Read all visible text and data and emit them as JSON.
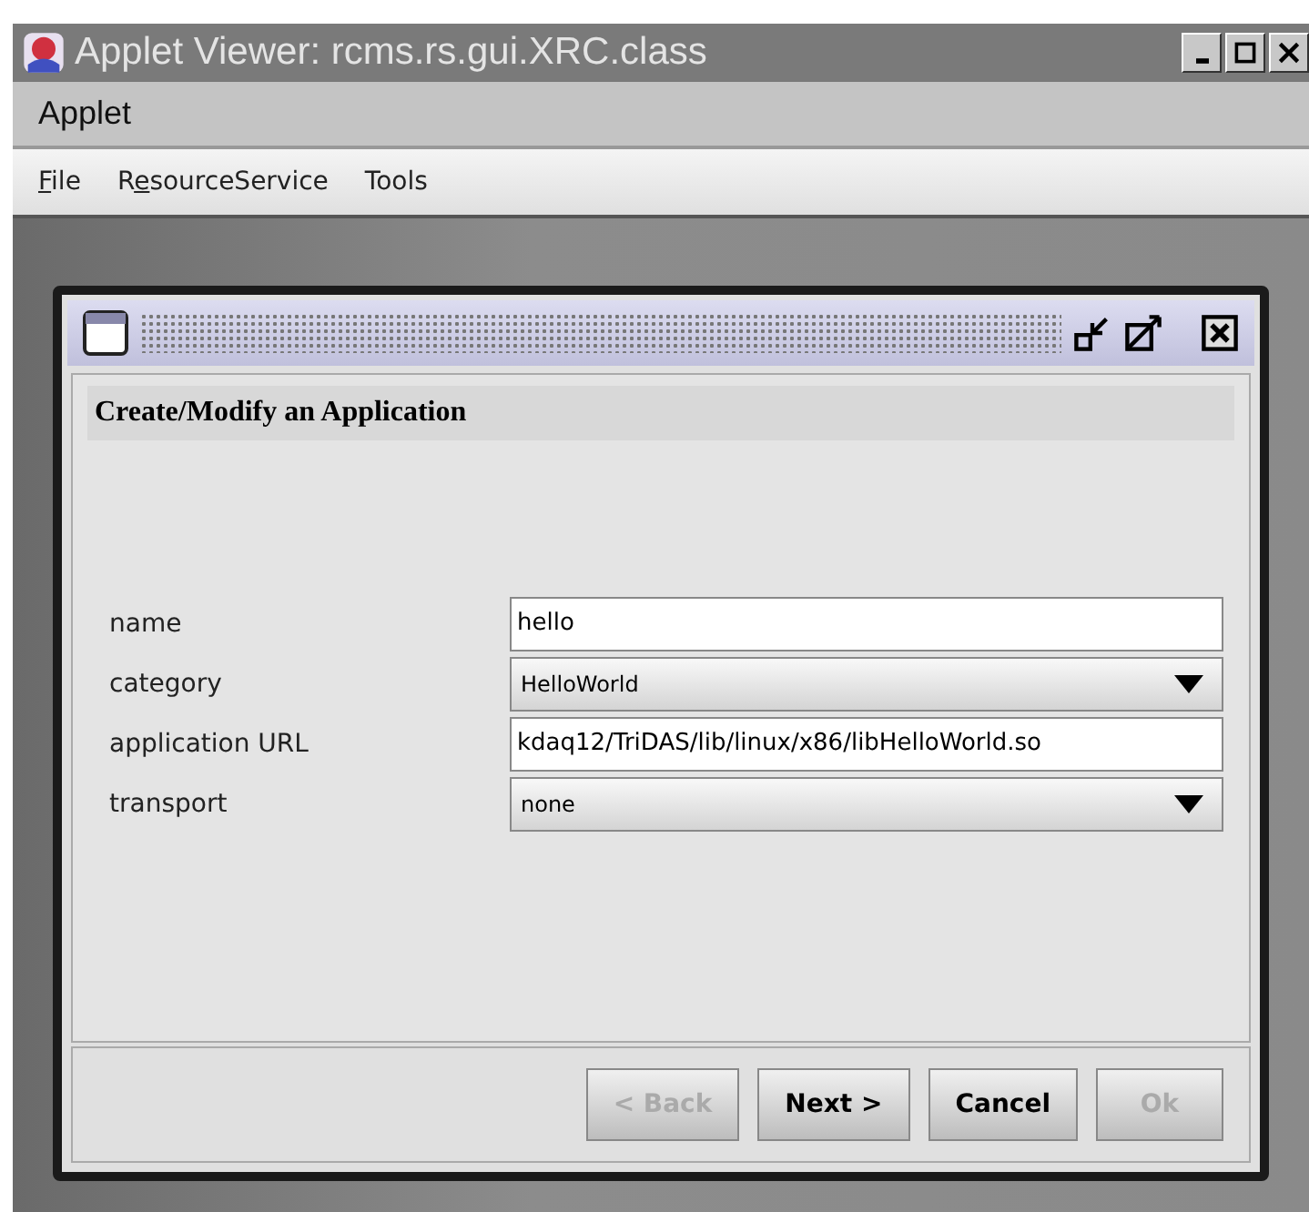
{
  "window": {
    "title": "Applet Viewer: rcms.rs.gui.XRC.class"
  },
  "applet_menu": [
    "Applet"
  ],
  "menu": [
    {
      "underlined": "F",
      "text_after": "ile"
    },
    {
      "text_before": "R",
      "underlined": "e",
      "text_after": "sourceService"
    },
    {
      "text_before": "Tools"
    }
  ],
  "dialog": {
    "heading": "Create/Modify an Application",
    "fields": [
      {
        "label": "name",
        "kind": "text",
        "value": "hello"
      },
      {
        "label": "category",
        "kind": "combo",
        "value": "HelloWorld"
      },
      {
        "label": "application URL",
        "kind": "text",
        "value": "kdaq12/TriDAS/lib/linux/x86/libHelloWorld.so"
      },
      {
        "label": "transport",
        "kind": "combo",
        "value": "none"
      }
    ],
    "buttons": [
      {
        "label": "< Back",
        "disabled": true
      },
      {
        "label": "Next >",
        "disabled": false
      },
      {
        "label": "Cancel",
        "disabled": false
      },
      {
        "label": "Ok",
        "disabled": true
      }
    ]
  }
}
